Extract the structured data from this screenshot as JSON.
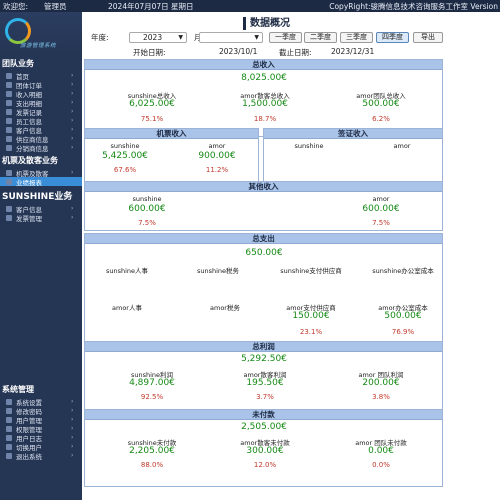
{
  "topbar": {
    "welcome": "欢迎您:",
    "role": "管理员",
    "date": "2024年07月07日 星期日",
    "copyright": "CopyRight:骏腾信息技术咨询服务工作室 Version"
  },
  "sidebar": {
    "logo_text": "旅游管理系统",
    "sections": [
      {
        "title": "团队业务",
        "items": [
          "首页",
          "团体订单",
          "收入明细",
          "支出明细",
          "发票记录",
          "员工信息",
          "客户信息",
          "供应商信息",
          "分销商信息"
        ]
      },
      {
        "title": "机票及散客业务",
        "items": [
          "机票及散客",
          "业绩报表"
        ]
      },
      {
        "title": "SUNSHINE业务",
        "items": [
          "客户信息",
          "发票管理"
        ]
      },
      {
        "title": "系统管理",
        "items": [
          "系统设置",
          "修改密码",
          "用户管理",
          "权限管理",
          "用户日志",
          "切换用户",
          "退出系统"
        ]
      }
    ]
  },
  "main": {
    "title": "数据概况",
    "filters": {
      "year_label": "年度:",
      "year_value": "2023",
      "month_label": "月度:",
      "month_value": "",
      "quarters": [
        "一季度",
        "二季度",
        "三季度",
        "四季度"
      ],
      "export_label": "导出"
    },
    "dates": {
      "start_label": "开始日期:",
      "start_value": "2023/10/1",
      "end_label": "截止日期:",
      "end_value": "2023/12/31"
    },
    "total_income": {
      "title": "总收入",
      "total": "8,025.00€",
      "items": [
        {
          "name": "sunshine总收入",
          "value": "6,025.00€",
          "pct": "75.1%"
        },
        {
          "name": "amor散客总收入",
          "value": "1,500.00€",
          "pct": "18.7%"
        },
        {
          "name": "amor团队总收入",
          "value": "500.00€",
          "pct": "6.2%"
        }
      ]
    },
    "ticket_income": {
      "title": "机票收入",
      "items": [
        {
          "name": "sunshine",
          "value": "5,425.00€",
          "pct": "67.6%"
        },
        {
          "name": "amor",
          "value": "900.00€",
          "pct": "11.2%"
        }
      ]
    },
    "visa_income": {
      "title": "签证收入",
      "items": [
        {
          "name": "sunshine"
        },
        {
          "name": "amor"
        }
      ]
    },
    "other_income": {
      "title": "其他收入",
      "items": [
        {
          "name": "sunshine",
          "value": "600.00€",
          "pct": "7.5%"
        },
        {
          "name": "amor",
          "value": "600.00€",
          "pct": "7.5%"
        }
      ]
    },
    "total_expense": {
      "title": "总支出",
      "total": "650.00€",
      "row1": [
        "sunshine人事",
        "sunshine税务",
        "sunshine支付供应商",
        "sunshine办公室成本"
      ],
      "row2": [
        {
          "name": "amor人事"
        },
        {
          "name": "amor税务"
        },
        {
          "name": "amor支付供应商",
          "value": "150.00€",
          "pct": "23.1%"
        },
        {
          "name": "amor办公室成本",
          "value": "500.00€",
          "pct": "76.9%"
        }
      ]
    },
    "total_profit": {
      "title": "总利润",
      "total": "5,292.50€",
      "items": [
        {
          "name": "sunshine利润",
          "value": "4,897.00€",
          "pct": "92.5%"
        },
        {
          "name": "amor散客利润",
          "value": "195.50€",
          "pct": "3.7%"
        },
        {
          "name": "amor 团队利润",
          "value": "200.00€",
          "pct": "3.8%"
        }
      ]
    },
    "unpaid": {
      "title": "未付款",
      "total": "2,505.00€",
      "items": [
        {
          "name": "sunshine未付款",
          "value": "2,205.00€",
          "pct": "88.0%"
        },
        {
          "name": "amor散客未付款",
          "value": "300.00€",
          "pct": "12.0%"
        },
        {
          "name": "amor 团队未付款",
          "value": "0.00€",
          "pct": "0.0%"
        }
      ]
    },
    "colors": {
      "value_green": "#168a16",
      "pct_red": "#c0392b",
      "header_blue": "#a9c4e8"
    }
  }
}
